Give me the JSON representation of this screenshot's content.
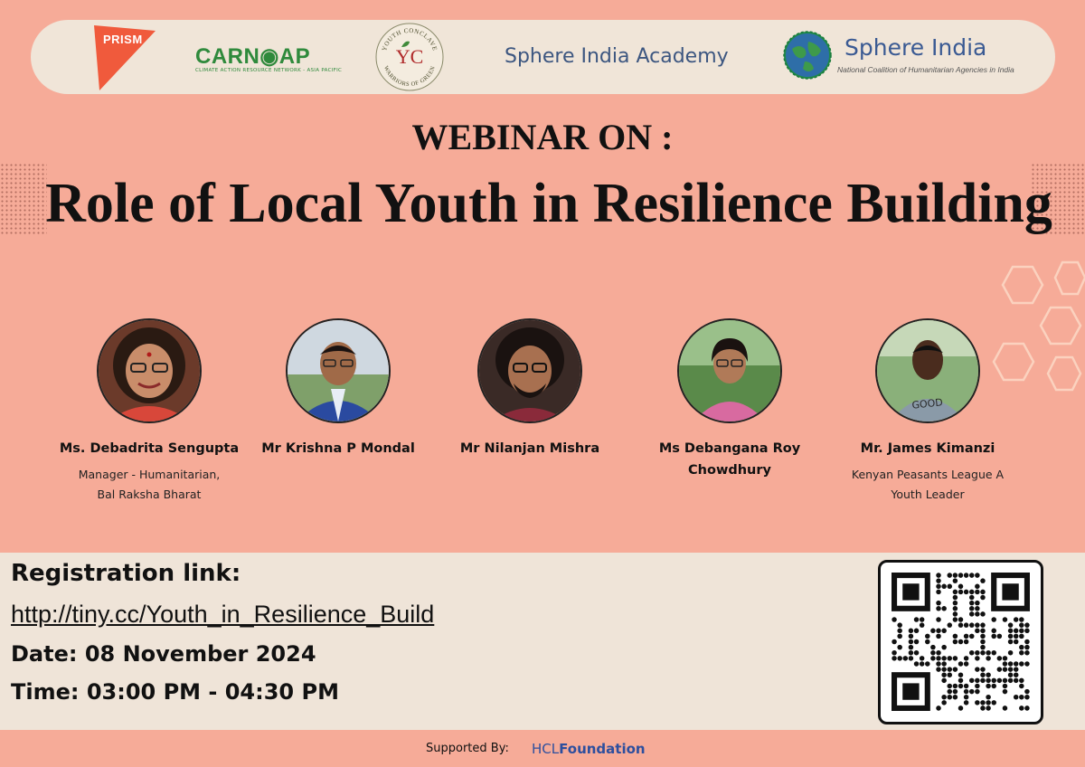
{
  "logos": {
    "prism": "PRISM",
    "carnoap": "CARN◉AP",
    "carnoap_sub": "CLIMATE ACTION RESOURCE NETWORK - ASIA PACIFIC",
    "yc_initials": "YC",
    "yc_ring_top": "YOUTH CONCLAVE",
    "yc_ring_bottom": "WARRIORS OF GREEN",
    "sphere_academy": "Sphere India Academy",
    "sphere_india": "Sphere India",
    "sphere_india_sub": "National Coalition of Humanitarian Agencies in India"
  },
  "heading": {
    "kicker": "WEBINAR ON :",
    "title": "Role of Local Youth in Resilience Building"
  },
  "speakers": [
    {
      "name": "Ms. Debadrita Sengupta",
      "role_line1": "Manager - Humanitarian,",
      "role_line2": "Bal Raksha Bharat"
    },
    {
      "name": "Mr Krishna P Mondal",
      "role_line1": "",
      "role_line2": ""
    },
    {
      "name": "Mr Nilanjan Mishra",
      "role_line1": "",
      "role_line2": ""
    },
    {
      "name_line1": "Ms Debangana Roy",
      "name_line2": "Chowdhury",
      "role_line1": "",
      "role_line2": ""
    },
    {
      "name": "Mr. James Kimanzi",
      "role_line1": "Kenyan Peasants League A",
      "role_line2": "Youth Leader"
    }
  ],
  "info": {
    "registration_label": "Registration link:",
    "registration_url": "http://tiny.cc/Youth_in_Resilience_Build",
    "date": "Date: 08 November 2024",
    "time": "Time: 03:00 PM - 04:30 PM"
  },
  "footer": {
    "supported_by": "Supported By:",
    "sponsor_a": "HCL",
    "sponsor_b": "Foundation"
  },
  "colors": {
    "background": "#f6ab98",
    "band": "#efe4d8",
    "sponsor": "#2d4f9e",
    "prism": "#f05a3c",
    "carnoap": "#2f8a3c"
  }
}
